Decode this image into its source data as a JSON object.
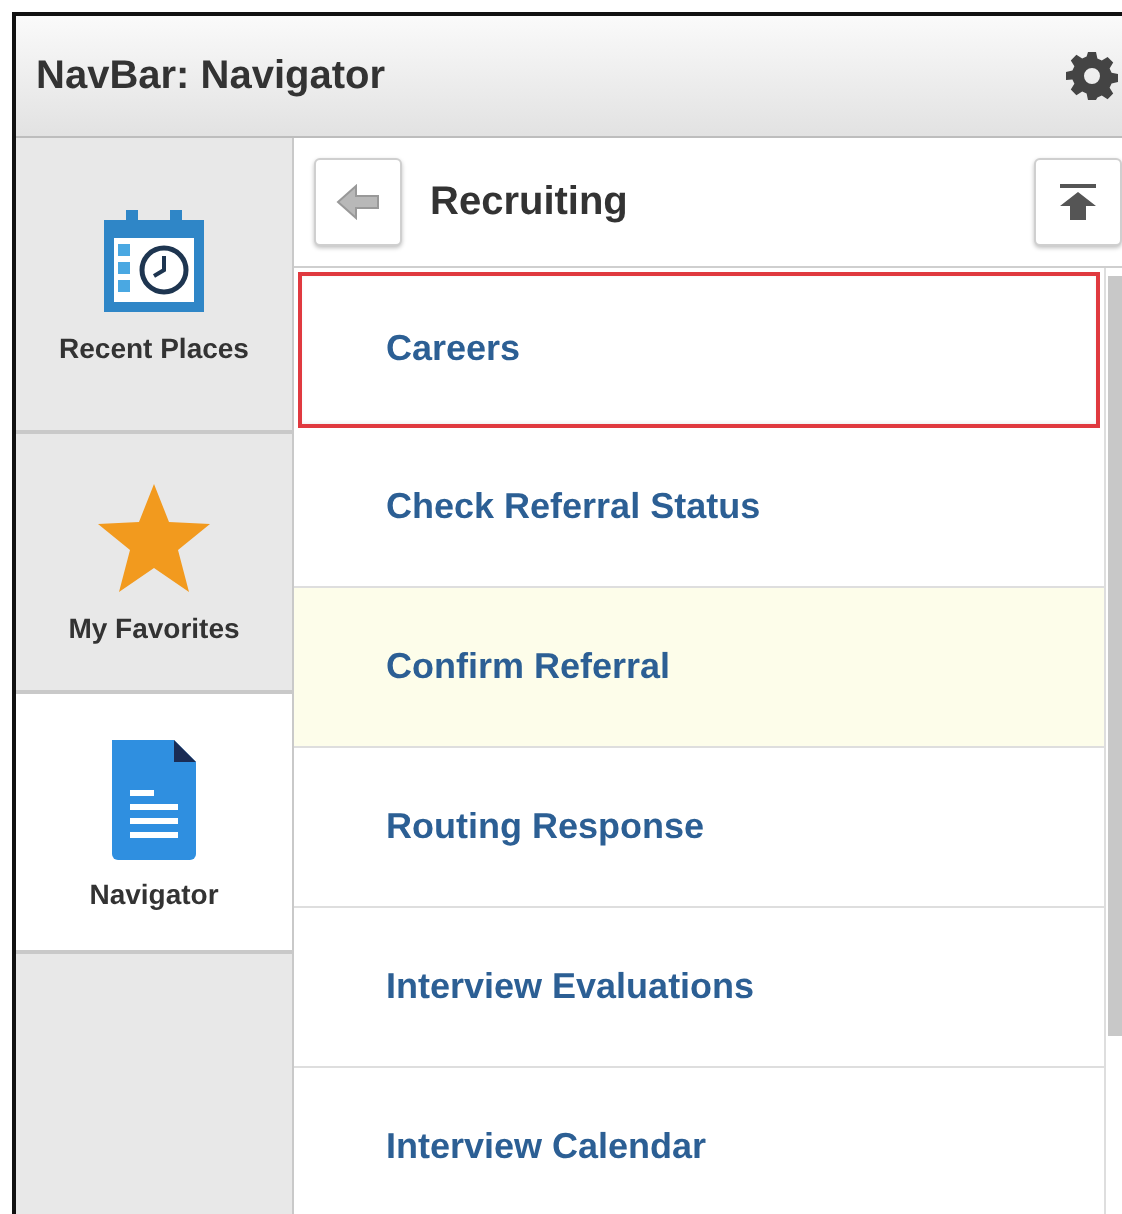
{
  "window": {
    "title": "NavBar: Navigator"
  },
  "sidebar": {
    "items": [
      {
        "label": "Recent Places",
        "kind": "calendar",
        "selected": false
      },
      {
        "label": "My Favorites",
        "kind": "star",
        "selected": false
      },
      {
        "label": "Navigator",
        "kind": "document",
        "selected": true
      }
    ]
  },
  "panel": {
    "title": "Recruiting",
    "items": [
      {
        "label": "Careers",
        "outlined": true,
        "selected": false
      },
      {
        "label": "Check Referral Status",
        "outlined": false,
        "selected": false
      },
      {
        "label": "Confirm Referral",
        "outlined": false,
        "selected": true
      },
      {
        "label": "Routing Response",
        "outlined": false,
        "selected": false
      },
      {
        "label": "Interview Evaluations",
        "outlined": false,
        "selected": false
      },
      {
        "label": "Interview Calendar",
        "outlined": false,
        "selected": false
      }
    ]
  }
}
